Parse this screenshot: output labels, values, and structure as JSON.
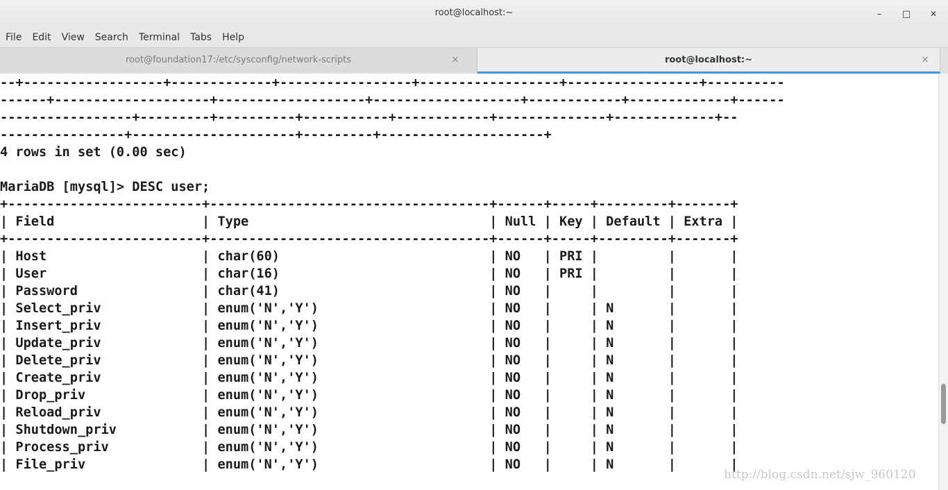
{
  "window": {
    "title": "root@localhost:~",
    "minimize_glyph": "–",
    "maximize_glyph": "□",
    "close_glyph": "✕"
  },
  "menu": [
    "File",
    "Edit",
    "View",
    "Search",
    "Terminal",
    "Tabs",
    "Help"
  ],
  "tabs": [
    {
      "label": "root@foundation17:/etc/sysconfig/network-scripts",
      "active": false,
      "close_glyph": "×"
    },
    {
      "label": "root@localhost:~",
      "active": true,
      "close_glyph": "×"
    }
  ],
  "terminal": {
    "lines": [
      "--+------------------+-------------+-----------------+------------------+-----------------+----------",
      "------+--------------------+-------------------+-------------------+------------+-------------+------",
      "-----------------+---------+----------+-----------+------------+--------------+-------------+--",
      "----------------+---------------------+---------+---------------------+",
      "4 rows in set (0.00 sec)",
      "",
      "MariaDB [mysql]> DESC user;",
      "+-------------------------+------------------------------------+------+-----+---------+-------+",
      "| Field                   | Type                               | Null | Key | Default | Extra |",
      "+-------------------------+------------------------------------+------+-----+---------+-------+",
      "| Host                    | char(60)                           | NO   | PRI |         |       |",
      "| User                    | char(16)                           | NO   | PRI |         |       |",
      "| Password                | char(41)                           | NO   |     |         |       |",
      "| Select_priv             | enum('N','Y')                      | NO   |     | N       |       |",
      "| Insert_priv             | enum('N','Y')                      | NO   |     | N       |       |",
      "| Update_priv             | enum('N','Y')                      | NO   |     | N       |       |",
      "| Delete_priv             | enum('N','Y')                      | NO   |     | N       |       |",
      "| Create_priv             | enum('N','Y')                      | NO   |     | N       |       |",
      "| Drop_priv               | enum('N','Y')                      | NO   |     | N       |       |",
      "| Reload_priv             | enum('N','Y')                      | NO   |     | N       |       |",
      "| Shutdown_priv           | enum('N','Y')                      | NO   |     | N       |       |",
      "| Process_priv            | enum('N','Y')                      | NO   |     | N       |       |",
      "| File_priv               | enum('N','Y')                      | NO   |     | N       |       |"
    ]
  },
  "watermark": "http://blog.csdn.net/sjw_960120"
}
